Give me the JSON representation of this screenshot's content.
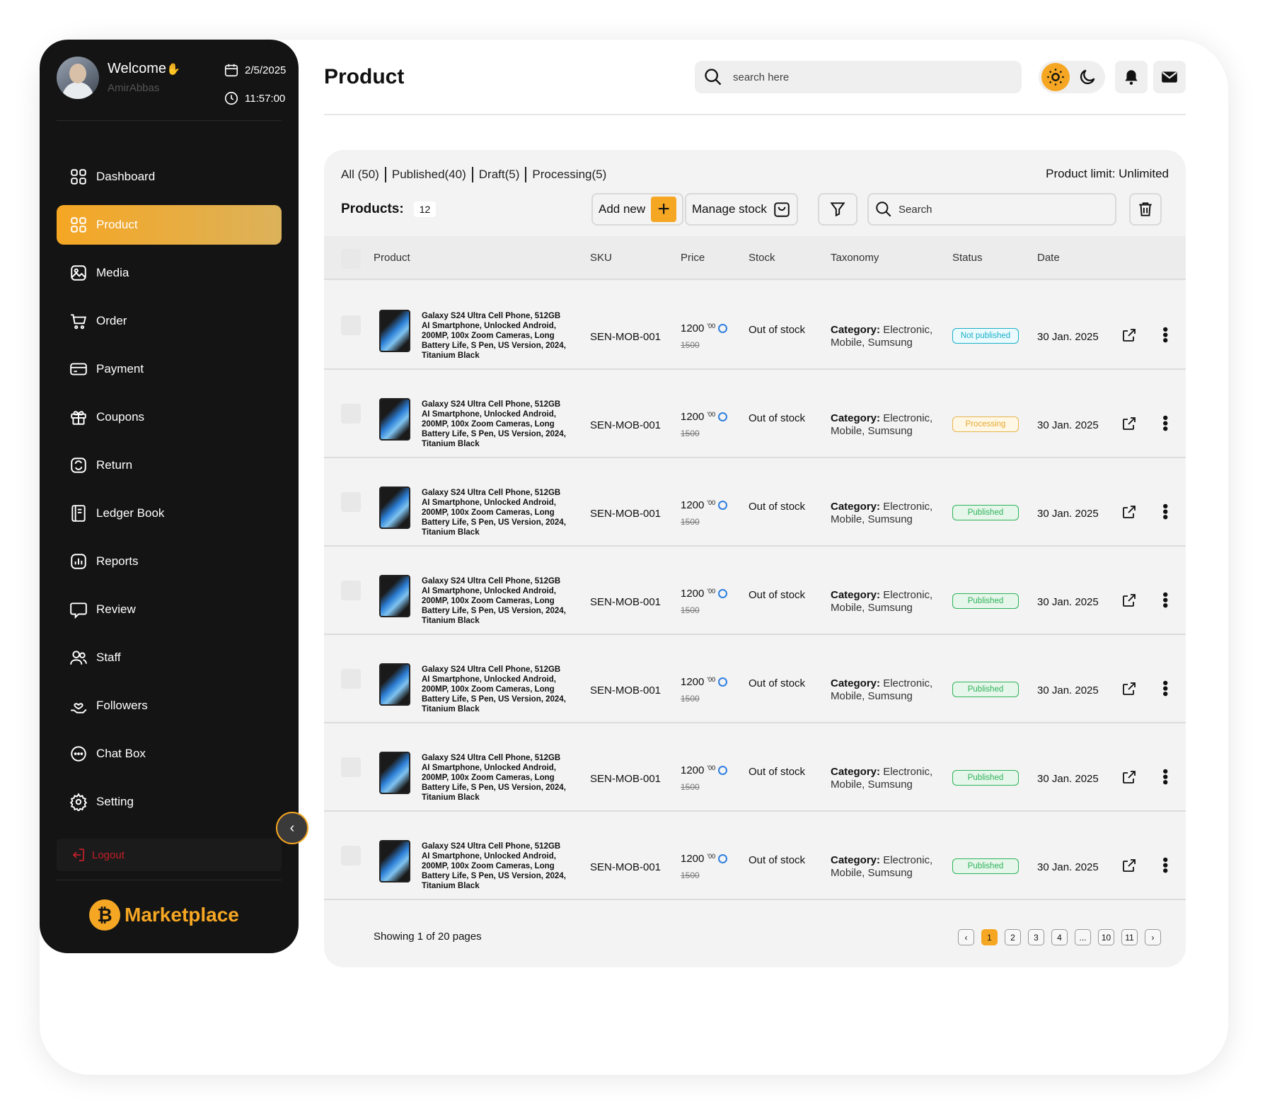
{
  "sidebar": {
    "welcome": "Welcome",
    "wave": "✋",
    "username": "AmirAbbas",
    "date": "2/5/2025",
    "time": "11:57:00",
    "items": [
      {
        "label": "Dashboard",
        "icon": "grid-icon"
      },
      {
        "label": "Product",
        "icon": "grid-icon",
        "active": true
      },
      {
        "label": "Media",
        "icon": "image-icon"
      },
      {
        "label": "Order",
        "icon": "cart-icon"
      },
      {
        "label": "Payment",
        "icon": "card-icon"
      },
      {
        "label": "Coupons",
        "icon": "gift-icon"
      },
      {
        "label": "Return",
        "icon": "return-icon"
      },
      {
        "label": "Ledger Book",
        "icon": "book-icon"
      },
      {
        "label": "Reports",
        "icon": "chart-icon"
      },
      {
        "label": "Review",
        "icon": "chat-bubble-icon"
      },
      {
        "label": "Staff",
        "icon": "users-icon"
      },
      {
        "label": "Followers",
        "icon": "heart-hand-icon"
      },
      {
        "label": "Chat Box",
        "icon": "chat-dots-icon"
      },
      {
        "label": "Setting",
        "icon": "gear-icon"
      }
    ],
    "logout": "Logout",
    "brand": "Marketplace",
    "accent": "#f5a623"
  },
  "header": {
    "title": "Product",
    "search_placeholder": "search here"
  },
  "panel": {
    "filters": [
      "All (50)",
      "Published(40)",
      "Draft(5)",
      "Processing(5)"
    ],
    "product_limit": "Product limit: Unlimited",
    "products_label": "Products:",
    "products_count": "12",
    "add_new": "Add new",
    "manage_stock": "Manage stock",
    "search_placeholder": "Search",
    "columns": {
      "product": "Product",
      "sku": "SKU",
      "price": "Price",
      "stock": "Stock",
      "taxonomy": "Taxonomy",
      "status": "Status",
      "date": "Date"
    },
    "rows": [
      {
        "name": "Galaxy S24 Ultra Cell Phone, 512GB AI Smartphone, Unlocked Android, 200MP, 100x Zoom Cameras, Long Battery Life, S Pen, US Version, 2024, Titanium Black",
        "sku": "SEN-MOB-001",
        "price": "1200",
        "price_dec": "'00",
        "old_price": "1500",
        "stock": "Out of stock",
        "tax_label": "Category:",
        "tax_value": "Electronic, Mobile, Sumsung",
        "status": "Not published",
        "status_type": "np",
        "date": "30 Jan. 2025"
      },
      {
        "name": "Galaxy S24 Ultra Cell Phone, 512GB AI Smartphone, Unlocked Android, 200MP, 100x Zoom Cameras, Long Battery Life, S Pen, US Version, 2024, Titanium Black",
        "sku": "SEN-MOB-001",
        "price": "1200",
        "price_dec": "'00",
        "old_price": "1500",
        "stock": "Out of stock",
        "tax_label": "Category:",
        "tax_value": "Electronic, Mobile, Sumsung",
        "status": "Processing",
        "status_type": "pr",
        "date": "30 Jan. 2025"
      },
      {
        "name": "Galaxy S24 Ultra Cell Phone, 512GB AI Smartphone, Unlocked Android, 200MP, 100x Zoom Cameras, Long Battery Life, S Pen, US Version, 2024, Titanium Black",
        "sku": "SEN-MOB-001",
        "price": "1200",
        "price_dec": "'00",
        "old_price": "1500",
        "stock": "Out of stock",
        "tax_label": "Category:",
        "tax_value": "Electronic, Mobile, Sumsung",
        "status": "Published",
        "status_type": "pu",
        "date": "30 Jan. 2025"
      },
      {
        "name": "Galaxy S24 Ultra Cell Phone, 512GB AI Smartphone, Unlocked Android, 200MP, 100x Zoom Cameras, Long Battery Life, S Pen, US Version, 2024, Titanium Black",
        "sku": "SEN-MOB-001",
        "price": "1200",
        "price_dec": "'00",
        "old_price": "1500",
        "stock": "Out of stock",
        "tax_label": "Category:",
        "tax_value": "Electronic, Mobile, Sumsung",
        "status": "Published",
        "status_type": "pu",
        "date": "30 Jan. 2025"
      },
      {
        "name": "Galaxy S24 Ultra Cell Phone, 512GB AI Smartphone, Unlocked Android, 200MP, 100x Zoom Cameras, Long Battery Life, S Pen, US Version, 2024, Titanium Black",
        "sku": "SEN-MOB-001",
        "price": "1200",
        "price_dec": "'00",
        "old_price": "1500",
        "stock": "Out of stock",
        "tax_label": "Category:",
        "tax_value": "Electronic, Mobile, Sumsung",
        "status": "Published",
        "status_type": "pu",
        "date": "30 Jan. 2025"
      },
      {
        "name": "Galaxy S24 Ultra Cell Phone, 512GB AI Smartphone, Unlocked Android, 200MP, 100x Zoom Cameras, Long Battery Life, S Pen, US Version, 2024, Titanium Black",
        "sku": "SEN-MOB-001",
        "price": "1200",
        "price_dec": "'00",
        "old_price": "1500",
        "stock": "Out of stock",
        "tax_label": "Category:",
        "tax_value": "Electronic, Mobile, Sumsung",
        "status": "Published",
        "status_type": "pu",
        "date": "30 Jan. 2025"
      },
      {
        "name": "Galaxy S24 Ultra Cell Phone, 512GB AI Smartphone, Unlocked Android, 200MP, 100x Zoom Cameras, Long Battery Life, S Pen, US Version, 2024, Titanium Black",
        "sku": "SEN-MOB-001",
        "price": "1200",
        "price_dec": "'00",
        "old_price": "1500",
        "stock": "Out of stock",
        "tax_label": "Category:",
        "tax_value": "Electronic, Mobile, Sumsung",
        "status": "Published",
        "status_type": "pu",
        "date": "30 Jan. 2025"
      }
    ],
    "showing": "Showing 1 of 20 pages",
    "pages": [
      "‹",
      "1",
      "2",
      "3",
      "4",
      "...",
      "10",
      "11",
      "›"
    ],
    "current_page": "1"
  }
}
